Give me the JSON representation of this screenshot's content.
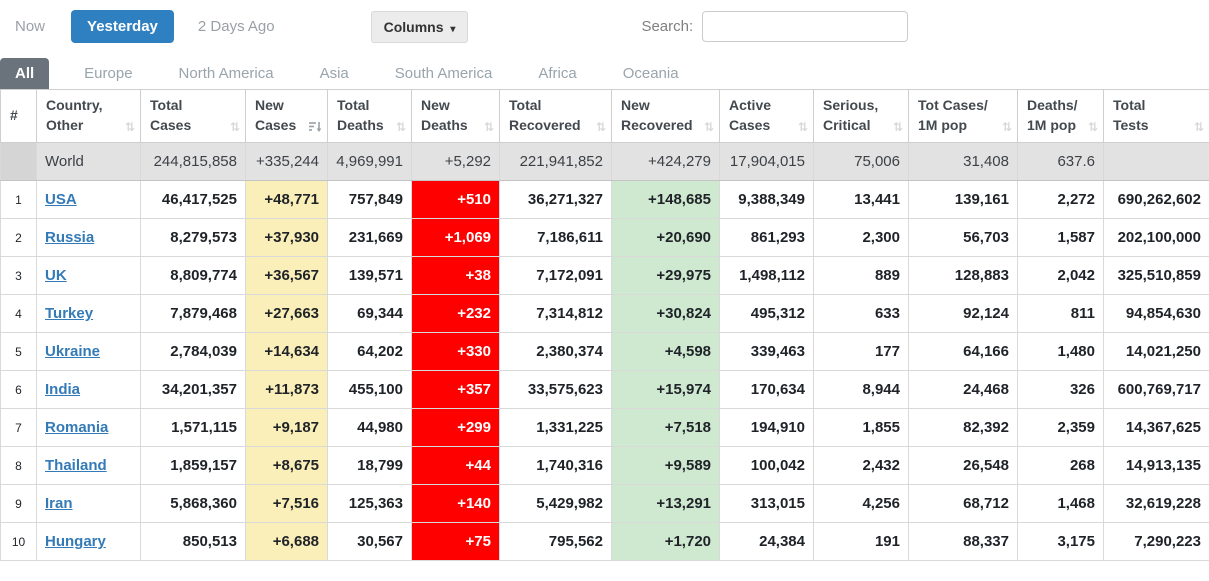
{
  "toolbar": {
    "now": "Now",
    "yesterday": "Yesterday",
    "two_days_ago": "2 Days Ago",
    "columns_label": "Columns",
    "search_label": "Search:",
    "search_value": ""
  },
  "tabs": [
    {
      "label": "All",
      "active": true
    },
    {
      "label": "Europe",
      "active": false
    },
    {
      "label": "North America",
      "active": false
    },
    {
      "label": "Asia",
      "active": false
    },
    {
      "label": "South America",
      "active": false
    },
    {
      "label": "Africa",
      "active": false
    },
    {
      "label": "Oceania",
      "active": false
    }
  ],
  "colors": {
    "accent_blue": "#2e80c0",
    "link_blue": "#337ab7",
    "new_cases_bg": "#faefb8",
    "new_deaths_bg": "#ff0000",
    "new_recovered_bg": "#cfe9d1",
    "world_row_bg": "#e2e2e2"
  },
  "table": {
    "columns": [
      {
        "key": "rank",
        "line1": "#",
        "line2": "",
        "sortable": false,
        "sorted": false
      },
      {
        "key": "country",
        "line1": "Country,",
        "line2": "Other",
        "sortable": true,
        "sorted": false
      },
      {
        "key": "total_cases",
        "line1": "Total",
        "line2": "Cases",
        "sortable": true,
        "sorted": false
      },
      {
        "key": "new_cases",
        "line1": "New",
        "line2": "Cases",
        "sortable": true,
        "sorted": true
      },
      {
        "key": "total_deaths",
        "line1": "Total",
        "line2": "Deaths",
        "sortable": true,
        "sorted": false
      },
      {
        "key": "new_deaths",
        "line1": "New",
        "line2": "Deaths",
        "sortable": true,
        "sorted": false
      },
      {
        "key": "total_recovered",
        "line1": "Total",
        "line2": "Recovered",
        "sortable": true,
        "sorted": false
      },
      {
        "key": "new_recovered",
        "line1": "New",
        "line2": "Recovered",
        "sortable": true,
        "sorted": false
      },
      {
        "key": "active_cases",
        "line1": "Active",
        "line2": "Cases",
        "sortable": true,
        "sorted": false
      },
      {
        "key": "serious_critical",
        "line1": "Serious,",
        "line2": "Critical",
        "sortable": true,
        "sorted": false
      },
      {
        "key": "tot_cases_1m",
        "line1": "Tot Cases/",
        "line2": "1M pop",
        "sortable": true,
        "sorted": false
      },
      {
        "key": "deaths_1m",
        "line1": "Deaths/",
        "line2": "1M pop",
        "sortable": true,
        "sorted": false
      },
      {
        "key": "total_tests",
        "line1": "Total",
        "line2": "Tests",
        "sortable": true,
        "sorted": false
      }
    ],
    "world_row": {
      "country": "World",
      "total_cases": "244,815,858",
      "new_cases": "+335,244",
      "total_deaths": "4,969,991",
      "new_deaths": "+5,292",
      "total_recovered": "221,941,852",
      "new_recovered": "+424,279",
      "active_cases": "17,904,015",
      "serious_critical": "75,006",
      "tot_cases_1m": "31,408",
      "deaths_1m": "637.6",
      "total_tests": ""
    },
    "rows": [
      {
        "rank": "1",
        "country": "USA",
        "total_cases": "46,417,525",
        "new_cases": "+48,771",
        "total_deaths": "757,849",
        "new_deaths": "+510",
        "total_recovered": "36,271,327",
        "new_recovered": "+148,685",
        "active_cases": "9,388,349",
        "serious_critical": "13,441",
        "tot_cases_1m": "139,161",
        "deaths_1m": "2,272",
        "total_tests": "690,262,602"
      },
      {
        "rank": "2",
        "country": "Russia",
        "total_cases": "8,279,573",
        "new_cases": "+37,930",
        "total_deaths": "231,669",
        "new_deaths": "+1,069",
        "total_recovered": "7,186,611",
        "new_recovered": "+20,690",
        "active_cases": "861,293",
        "serious_critical": "2,300",
        "tot_cases_1m": "56,703",
        "deaths_1m": "1,587",
        "total_tests": "202,100,000"
      },
      {
        "rank": "3",
        "country": "UK",
        "total_cases": "8,809,774",
        "new_cases": "+36,567",
        "total_deaths": "139,571",
        "new_deaths": "+38",
        "total_recovered": "7,172,091",
        "new_recovered": "+29,975",
        "active_cases": "1,498,112",
        "serious_critical": "889",
        "tot_cases_1m": "128,883",
        "deaths_1m": "2,042",
        "total_tests": "325,510,859"
      },
      {
        "rank": "4",
        "country": "Turkey",
        "total_cases": "7,879,468",
        "new_cases": "+27,663",
        "total_deaths": "69,344",
        "new_deaths": "+232",
        "total_recovered": "7,314,812",
        "new_recovered": "+30,824",
        "active_cases": "495,312",
        "serious_critical": "633",
        "tot_cases_1m": "92,124",
        "deaths_1m": "811",
        "total_tests": "94,854,630"
      },
      {
        "rank": "5",
        "country": "Ukraine",
        "total_cases": "2,784,039",
        "new_cases": "+14,634",
        "total_deaths": "64,202",
        "new_deaths": "+330",
        "total_recovered": "2,380,374",
        "new_recovered": "+4,598",
        "active_cases": "339,463",
        "serious_critical": "177",
        "tot_cases_1m": "64,166",
        "deaths_1m": "1,480",
        "total_tests": "14,021,250"
      },
      {
        "rank": "6",
        "country": "India",
        "total_cases": "34,201,357",
        "new_cases": "+11,873",
        "total_deaths": "455,100",
        "new_deaths": "+357",
        "total_recovered": "33,575,623",
        "new_recovered": "+15,974",
        "active_cases": "170,634",
        "serious_critical": "8,944",
        "tot_cases_1m": "24,468",
        "deaths_1m": "326",
        "total_tests": "600,769,717"
      },
      {
        "rank": "7",
        "country": "Romania",
        "total_cases": "1,571,115",
        "new_cases": "+9,187",
        "total_deaths": "44,980",
        "new_deaths": "+299",
        "total_recovered": "1,331,225",
        "new_recovered": "+7,518",
        "active_cases": "194,910",
        "serious_critical": "1,855",
        "tot_cases_1m": "82,392",
        "deaths_1m": "2,359",
        "total_tests": "14,367,625"
      },
      {
        "rank": "8",
        "country": "Thailand",
        "total_cases": "1,859,157",
        "new_cases": "+8,675",
        "total_deaths": "18,799",
        "new_deaths": "+44",
        "total_recovered": "1,740,316",
        "new_recovered": "+9,589",
        "active_cases": "100,042",
        "serious_critical": "2,432",
        "tot_cases_1m": "26,548",
        "deaths_1m": "268",
        "total_tests": "14,913,135"
      },
      {
        "rank": "9",
        "country": "Iran",
        "total_cases": "5,868,360",
        "new_cases": "+7,516",
        "total_deaths": "125,363",
        "new_deaths": "+140",
        "total_recovered": "5,429,982",
        "new_recovered": "+13,291",
        "active_cases": "313,015",
        "serious_critical": "4,256",
        "tot_cases_1m": "68,712",
        "deaths_1m": "1,468",
        "total_tests": "32,619,228"
      },
      {
        "rank": "10",
        "country": "Hungary",
        "total_cases": "850,513",
        "new_cases": "+6,688",
        "total_deaths": "30,567",
        "new_deaths": "+75",
        "total_recovered": "795,562",
        "new_recovered": "+1,720",
        "active_cases": "24,384",
        "serious_critical": "191",
        "tot_cases_1m": "88,337",
        "deaths_1m": "3,175",
        "total_tests": "7,290,223"
      }
    ]
  }
}
